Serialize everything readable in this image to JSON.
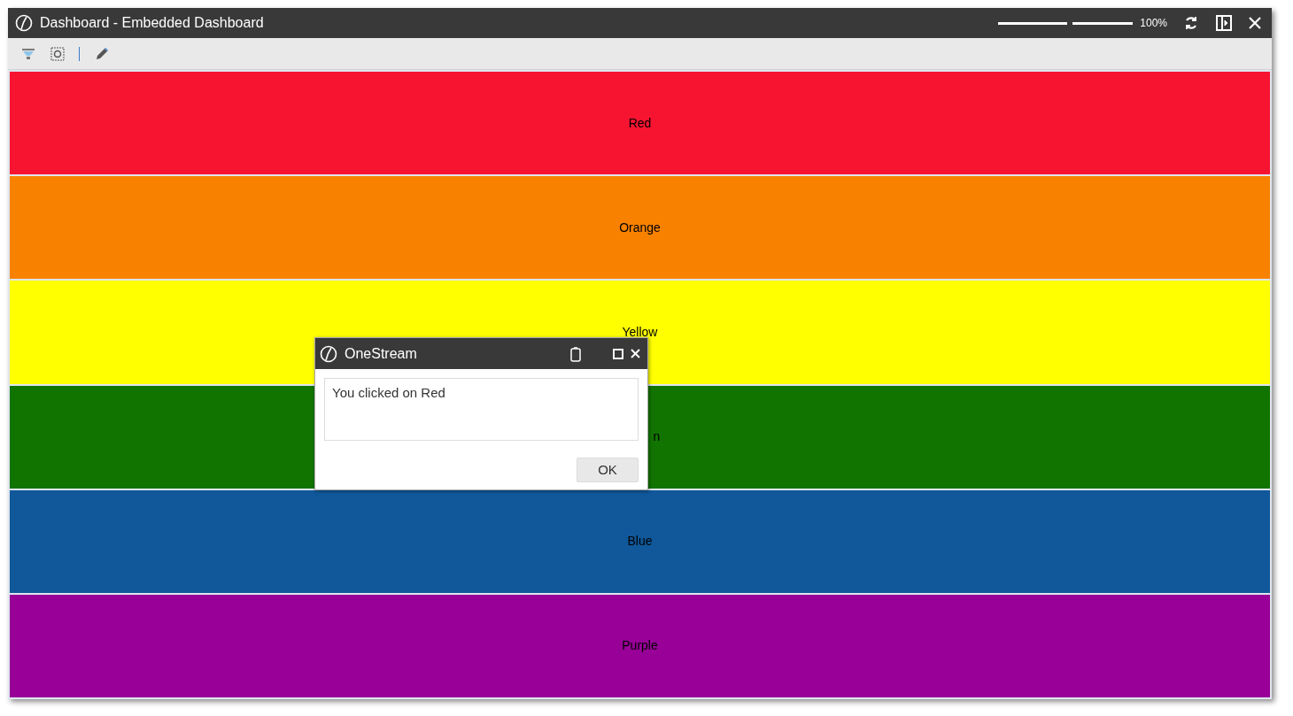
{
  "window": {
    "title": "Dashboard - Embedded Dashboard"
  },
  "zoom": {
    "level": 0.53,
    "reading": "100%"
  },
  "bands": [
    {
      "label": "Red",
      "color": "#f71430"
    },
    {
      "label": "Orange",
      "color": "#f88200"
    },
    {
      "label": "Yellow",
      "color": "#ffff00"
    },
    {
      "label": "n",
      "color": "#127400",
      "covered": true
    },
    {
      "label": "Blue",
      "color": "#10589a"
    },
    {
      "label": "Purple",
      "color": "#980098"
    }
  ],
  "dialog": {
    "title": "OneStream",
    "message": "You clicked on Red",
    "button": "OK"
  }
}
